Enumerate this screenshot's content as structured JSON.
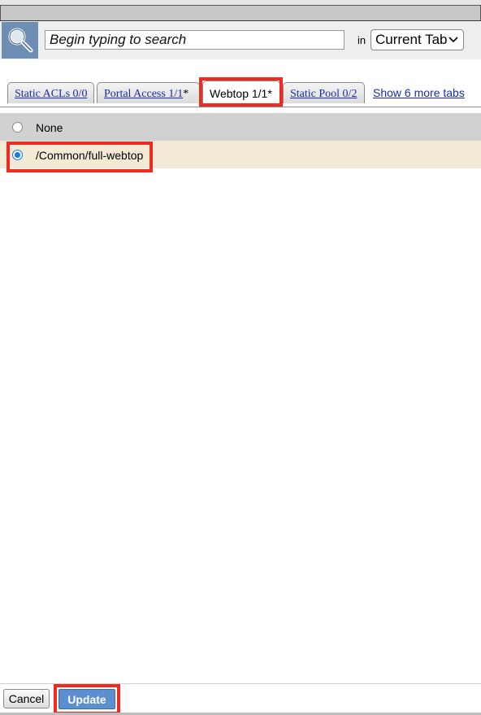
{
  "search": {
    "placeholder": "Begin typing to search",
    "in_label": "in",
    "scope_value": "Current Tab"
  },
  "tabs": [
    {
      "label": "Static ACLs 0/0",
      "star": "",
      "active": false
    },
    {
      "label": "Portal Access 1/1",
      "star": "*",
      "active": false
    },
    {
      "label": "Webtop 1/1*",
      "star": "",
      "active": true
    },
    {
      "label": "Static Pool 0/2",
      "star": "",
      "active": false
    }
  ],
  "more_tabs_label": "Show 6 more tabs",
  "options": [
    {
      "label": "None",
      "selected": false
    },
    {
      "label": "/Common/full-webtop",
      "selected": true
    }
  ],
  "buttons": {
    "cancel": "Cancel",
    "update": "Update"
  },
  "colors": {
    "highlight": "#ee2b22",
    "link": "#1a2ca8",
    "selected_row": "#f3ead6",
    "unselected_row": "#d1d1d1",
    "update_button": "#5d8fd0",
    "search_icon_bg": "#6e8fb3"
  }
}
